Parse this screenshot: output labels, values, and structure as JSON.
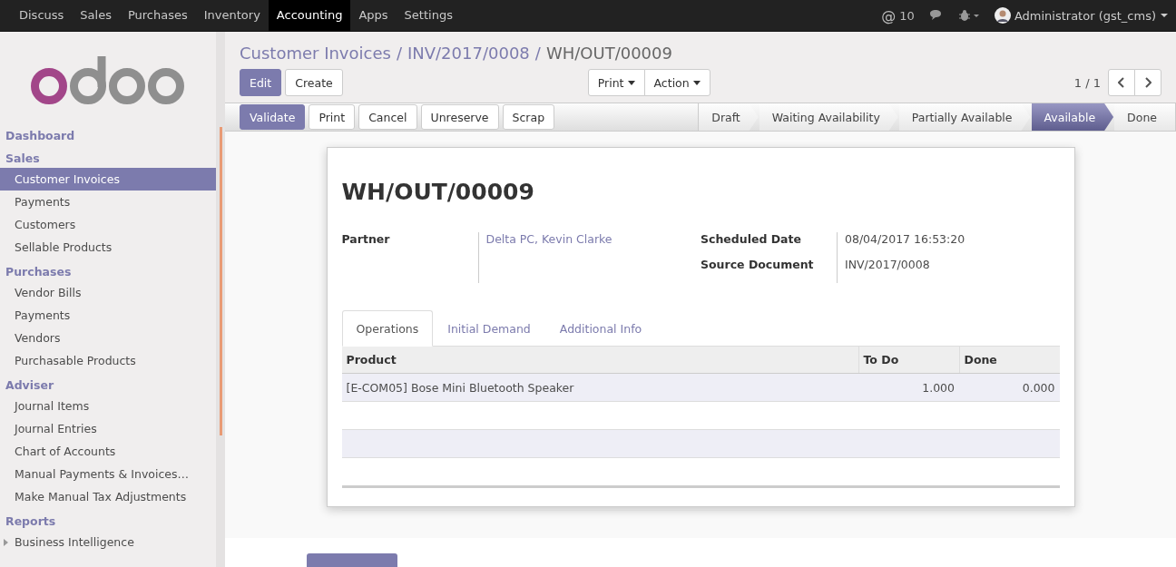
{
  "top_menu": [
    {
      "label": "Discuss",
      "selected": false
    },
    {
      "label": "Sales",
      "selected": false
    },
    {
      "label": "Purchases",
      "selected": false
    },
    {
      "label": "Inventory",
      "selected": false
    },
    {
      "label": "Accounting",
      "selected": true
    },
    {
      "label": "Apps",
      "selected": false
    },
    {
      "label": "Settings",
      "selected": false
    }
  ],
  "systray": {
    "mention_symbol": "@",
    "mentions": "10",
    "user": "Administrator (gst_cms)"
  },
  "sidebar": {
    "sections": [
      {
        "title": "Dashboard"
      },
      {
        "title": "Sales",
        "items": [
          {
            "label": "Customer Invoices",
            "selected": true,
            "expandable": false
          },
          {
            "label": "Payments",
            "selected": false,
            "expandable": false
          },
          {
            "label": "Customers",
            "selected": false,
            "expandable": false
          },
          {
            "label": "Sellable Products",
            "selected": false,
            "expandable": false
          }
        ]
      },
      {
        "title": "Purchases",
        "items": [
          {
            "label": "Vendor Bills",
            "selected": false,
            "expandable": false
          },
          {
            "label": "Payments",
            "selected": false,
            "expandable": false
          },
          {
            "label": "Vendors",
            "selected": false,
            "expandable": false
          },
          {
            "label": "Purchasable Products",
            "selected": false,
            "expandable": false
          }
        ]
      },
      {
        "title": "Adviser",
        "items": [
          {
            "label": "Journal Items",
            "selected": false,
            "expandable": false
          },
          {
            "label": "Journal Entries",
            "selected": false,
            "expandable": false
          },
          {
            "label": "Chart of Accounts",
            "selected": false,
            "expandable": false
          },
          {
            "label": "Manual Payments & Invoices…",
            "selected": false,
            "expandable": false
          },
          {
            "label": "Make Manual Tax Adjustments",
            "selected": false,
            "expandable": false
          }
        ]
      },
      {
        "title": "Reports",
        "items": [
          {
            "label": "Business Intelligence",
            "selected": false,
            "expandable": true
          }
        ]
      }
    ]
  },
  "breadcrumbs": [
    {
      "label": "Customer Invoices",
      "separator": "/"
    },
    {
      "label": "INV/2017/0008",
      "separator": "/"
    },
    {
      "label": "WH/OUT/00009"
    }
  ],
  "actions": {
    "primary": "Edit",
    "secondary": "Create",
    "dropdowns": [
      "Print",
      "Action"
    ],
    "pager": "1 / 1"
  },
  "header_buttons": [
    {
      "label": "Validate",
      "kind": "validate"
    },
    {
      "label": "Print",
      "kind": "print"
    },
    {
      "label": "Cancel",
      "kind": "cancel"
    },
    {
      "label": "Unreserve",
      "kind": "unreserve"
    },
    {
      "label": "Scrap",
      "kind": "scrap"
    }
  ],
  "stages": [
    {
      "label": "Draft",
      "selected": false
    },
    {
      "label": "Waiting Availability",
      "selected": false
    },
    {
      "label": "Partially Available",
      "selected": false
    },
    {
      "label": "Available",
      "selected": true
    },
    {
      "label": "Done",
      "selected": false
    }
  ],
  "record": {
    "title": "WH/OUT/00009",
    "left_fields": [
      {
        "label": "Partner",
        "value": "Delta PC, Kevin Clarke",
        "kind": "link"
      }
    ],
    "right_fields": [
      {
        "label": "Scheduled Date",
        "value": "08/04/2017 16:53:20",
        "kind": "text"
      },
      {
        "label": "Source Document",
        "value": "INV/2017/0008",
        "kind": "text"
      }
    ],
    "tabs": [
      {
        "label": "Operations",
        "selected": true
      },
      {
        "label": "Initial Demand",
        "selected": false
      },
      {
        "label": "Additional Info",
        "selected": false
      }
    ],
    "table": {
      "columns": [
        "Product",
        "To Do",
        "Done"
      ],
      "rows": [
        [
          "[E-COM05] Bose Mini Bluetooth Speaker",
          "1.000",
          "0.000"
        ]
      ]
    }
  }
}
